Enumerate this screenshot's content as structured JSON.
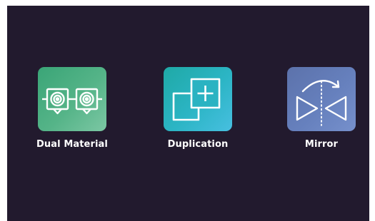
{
  "modes": [
    {
      "id": "dual-material",
      "label": "Dual Material",
      "icon": "dual-extruder-icon",
      "color": "#4daf83"
    },
    {
      "id": "duplication",
      "label": "Duplication",
      "icon": "duplicate-plus-icon",
      "color": "#2ab3c2"
    },
    {
      "id": "mirror",
      "label": "Mirror",
      "icon": "mirror-flip-icon",
      "color": "#6680bd"
    }
  ],
  "colors": {
    "screen_background": "#221a2e",
    "label_text": "#ffffff"
  }
}
